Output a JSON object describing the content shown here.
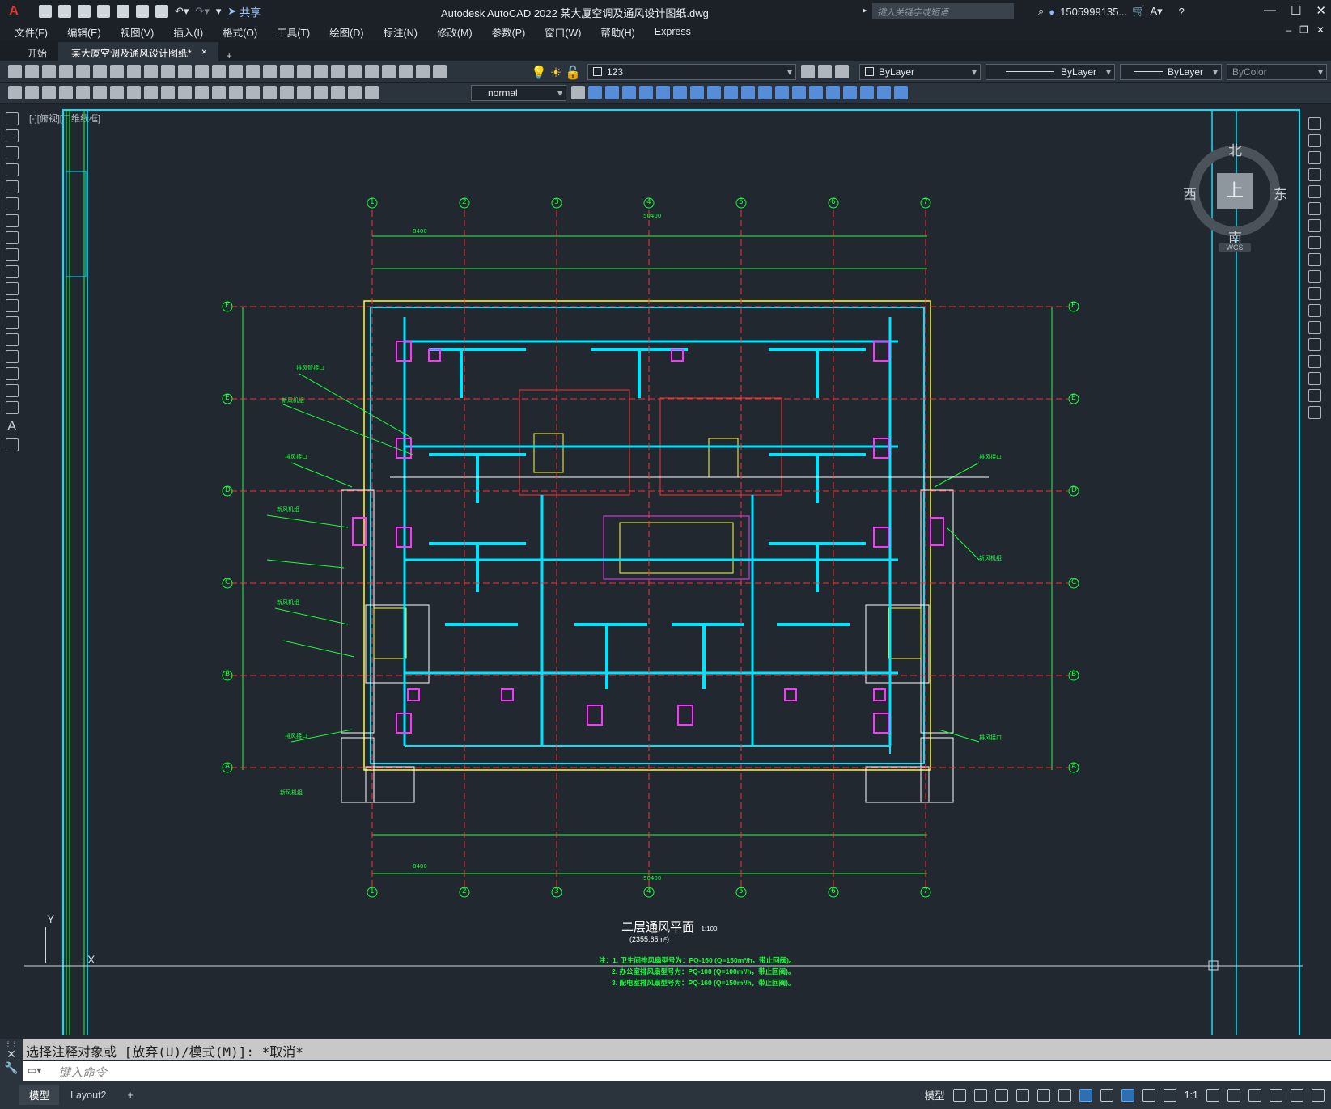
{
  "app": {
    "logo": "A",
    "title": "Autodesk AutoCAD 2022    某大厦空调及通风设计图纸.dwg",
    "share": "共享",
    "search_placeholder": "键入关键字或短语",
    "user": "1505999135...",
    "help": "?"
  },
  "menu": [
    "文件(F)",
    "编辑(E)",
    "视图(V)",
    "插入(I)",
    "格式(O)",
    "工具(T)",
    "绘图(D)",
    "标注(N)",
    "修改(M)",
    "参数(P)",
    "窗口(W)",
    "帮助(H)",
    "Express"
  ],
  "tabs": {
    "start": "开始",
    "active": "某大厦空调及通风设计图纸*",
    "close": "×",
    "add": "+"
  },
  "toolbar": {
    "layer": "123",
    "color": "ByLayer",
    "linetype": "ByLayer",
    "lineweight": "ByLayer",
    "plotstyle": "ByColor",
    "textstyle": "normal"
  },
  "viewport_label": "[-][俯视][二维线框]",
  "viewcube": {
    "north": "北",
    "south": "南",
    "east": "东",
    "west": "西",
    "face": "上",
    "wcs": "WCS"
  },
  "ucs": {
    "x": "X",
    "y": "Y"
  },
  "drawing": {
    "title": "二层通风平面",
    "scale": "1:100",
    "area": "(2355.65m²)",
    "notes": [
      "注：1. 卫生间排风扇型号为：PQ-160 (Q=150m³/h，带止回阀)。",
      "2. 办公室排风扇型号为：PQ-100 (Q=100m³/h，带止回阀)。",
      "3. 配电室排风扇型号为：PQ-160 (Q=150m³/h，带止回阀)。"
    ],
    "col_axes": [
      "1",
      "2",
      "3",
      "4",
      "5",
      "6",
      "7"
    ],
    "row_axes": [
      "F",
      "E",
      "D",
      "C",
      "B",
      "A"
    ],
    "total_dim": "50400",
    "bay_dim": "8400"
  },
  "command": {
    "history": "选择注释对象或 [放弃(U)/模式(M)]: *取消*",
    "placeholder": "键入命令"
  },
  "status": {
    "tabs": [
      "模型",
      "Layout2"
    ],
    "add": "+",
    "model": "模型",
    "scale": "1:1"
  },
  "colors": {
    "cyan": "#00e5ff",
    "green": "#19ff3c",
    "yellow": "#ffff33",
    "red": "#ff3030",
    "magenta": "#ff33ff",
    "white": "#ffffff",
    "blue": "#3a6dff"
  }
}
